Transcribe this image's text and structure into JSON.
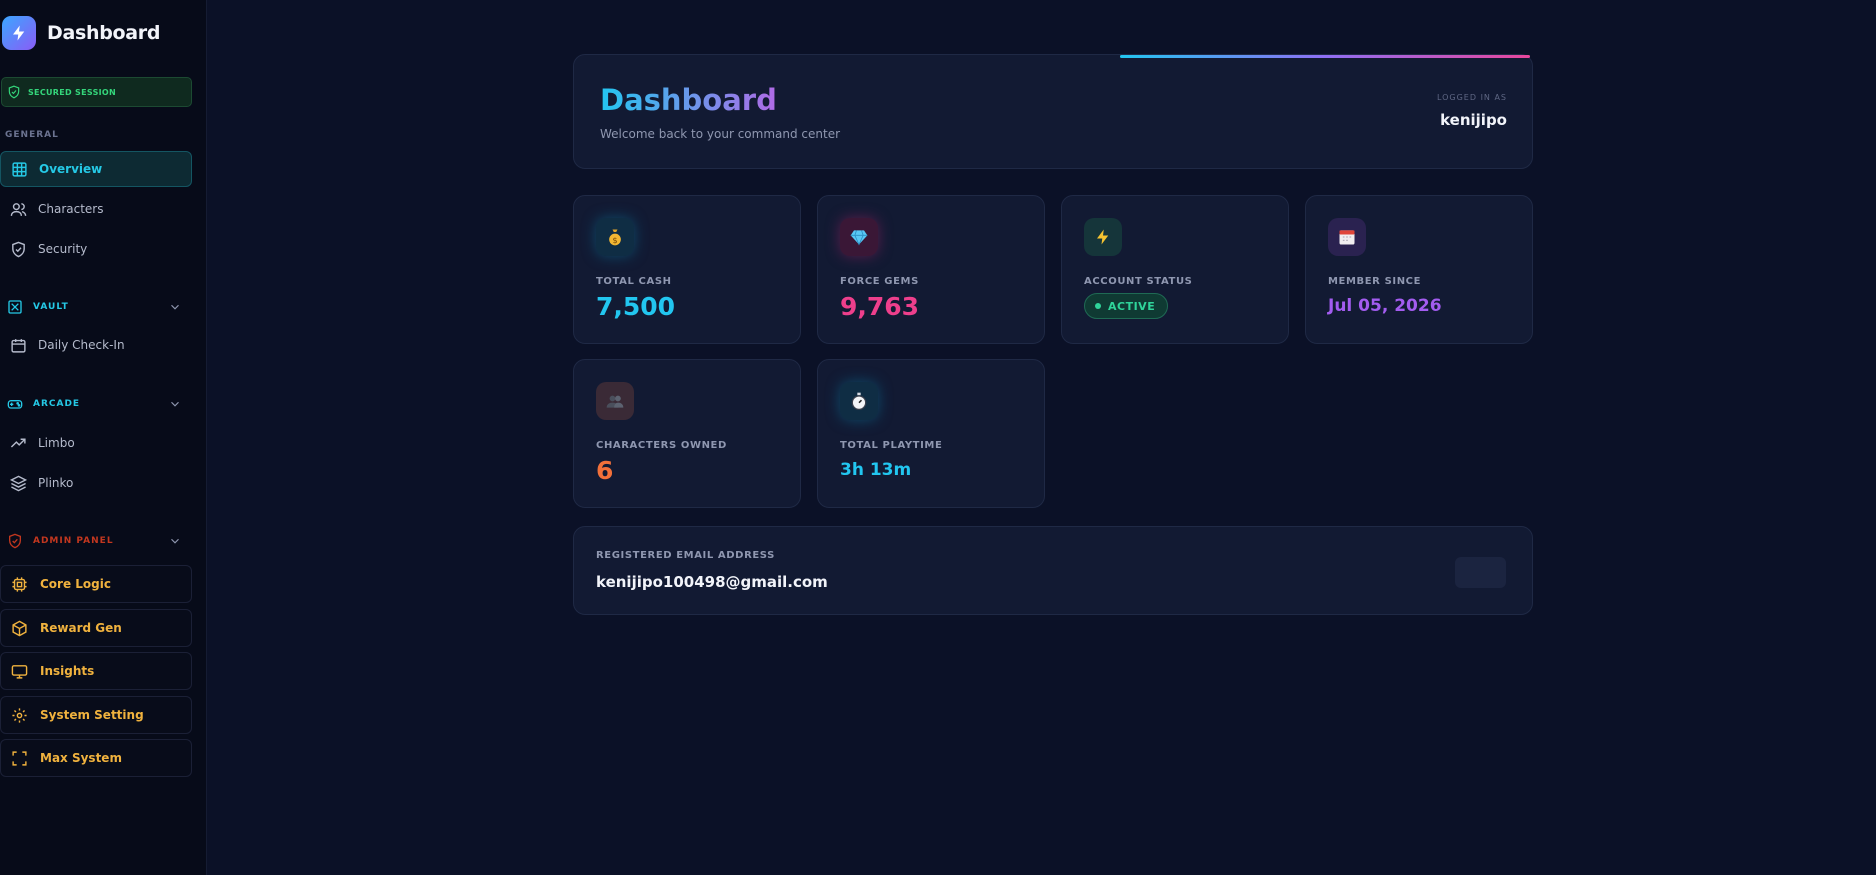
{
  "brand": {
    "title": "Dashboard",
    "icon": "bolt-icon"
  },
  "sidebar": {
    "session_label": "SECURED SESSION",
    "general_label": "GENERAL",
    "general_items": [
      {
        "label": "Overview",
        "icon": "grid-icon",
        "active": true
      },
      {
        "label": "Characters",
        "icon": "users-icon"
      },
      {
        "label": "Security",
        "icon": "shield-icon"
      }
    ],
    "vault": {
      "label": "VAULT",
      "items": [
        {
          "label": "Daily Check-In",
          "icon": "calendar-icon"
        }
      ]
    },
    "arcade": {
      "label": "ARCADE",
      "items": [
        {
          "label": "Limbo",
          "icon": "trend-icon"
        },
        {
          "label": "Plinko",
          "icon": "layers-icon"
        }
      ]
    },
    "admin": {
      "label": "ADMIN PANEL",
      "items": [
        {
          "label": "Core Logic",
          "icon": "cpu-icon"
        },
        {
          "label": "Reward Gen",
          "icon": "box-icon"
        },
        {
          "label": "Insights",
          "icon": "monitor-icon"
        },
        {
          "label": "System Setting",
          "icon": "gear-icon"
        },
        {
          "label": "Max System",
          "icon": "expand-icon"
        }
      ]
    }
  },
  "header": {
    "title": "Dashboard",
    "subtitle": "Welcome back to your command center",
    "logged_in_label": "LOGGED IN AS",
    "username": "kenijipo"
  },
  "stats": [
    {
      "label": "TOTAL CASH",
      "value": "7,500",
      "icon": "money-bag-icon",
      "color": "#22c6f0"
    },
    {
      "label": "FORCE GEMS",
      "value": "9,763",
      "icon": "gem-icon",
      "color": "#ee3f8c"
    },
    {
      "label": "ACCOUNT STATUS",
      "value": "ACTIVE",
      "icon": "bolt-icon",
      "color": "#2fd49a"
    },
    {
      "label": "MEMBER SINCE",
      "value": "Jul 05, 2026",
      "icon": "calendar-icon",
      "color": "#a35cf0"
    },
    {
      "label": "CHARACTERS OWNED",
      "value": "6",
      "icon": "people-icon",
      "color": "#f2703a"
    },
    {
      "label": "TOTAL PLAYTIME",
      "value": "3h 13m",
      "icon": "stopwatch-icon",
      "color": "#22c6f0"
    }
  ],
  "email": {
    "label": "REGISTERED EMAIL ADDRESS",
    "value": "kenijipo100498@gmail.com"
  }
}
